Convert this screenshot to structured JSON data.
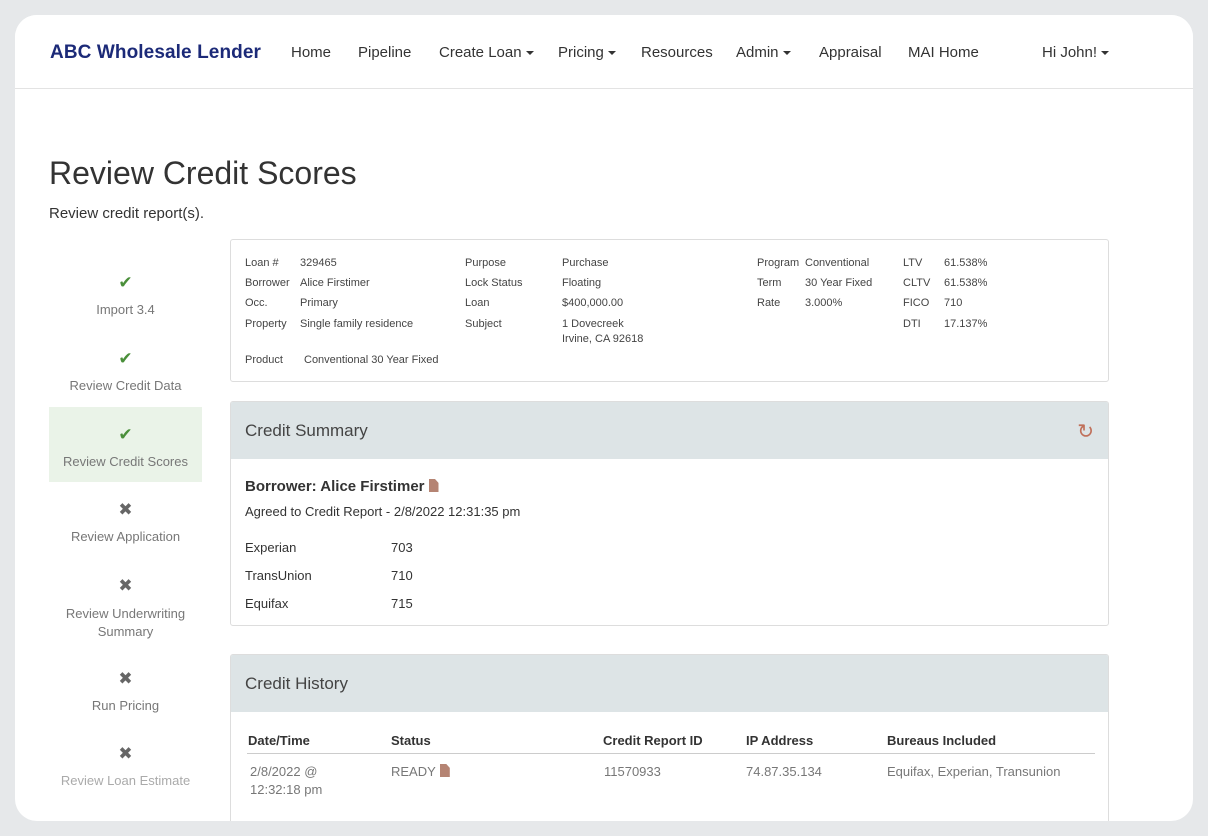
{
  "nav": {
    "brand": "ABC Wholesale Lender",
    "items": [
      {
        "label": "Home",
        "dropdown": false
      },
      {
        "label": "Pipeline",
        "dropdown": false
      },
      {
        "label": "Create Loan",
        "dropdown": true
      },
      {
        "label": "Pricing",
        "dropdown": true
      },
      {
        "label": "Resources",
        "dropdown": false
      },
      {
        "label": "Admin",
        "dropdown": true
      },
      {
        "label": "Appraisal",
        "dropdown": false
      },
      {
        "label": "MAI Home",
        "dropdown": false
      }
    ],
    "user": "Hi John!"
  },
  "page": {
    "title": "Review Credit Scores",
    "subtitle": "Review credit report(s)."
  },
  "steps": [
    {
      "label": "Import 3.4",
      "status": "check-icon"
    },
    {
      "label": "Review Credit Data",
      "status": "check-icon"
    },
    {
      "label": "Review Credit Scores",
      "status": "check-icon",
      "active": true
    },
    {
      "label": "Review Application",
      "status": "cross-icon"
    },
    {
      "label": "Review Underwriting Summary",
      "status": "cross-icon"
    },
    {
      "label": "Run Pricing",
      "status": "cross-icon"
    },
    {
      "label": "Review Loan Estimate",
      "status": "cross-icon"
    }
  ],
  "loan": {
    "loan_num_label": "Loan #",
    "loan_num": "329465",
    "borrower_label": "Borrower",
    "borrower": "Alice Firstimer",
    "occ_label": "Occ.",
    "occ": "Primary",
    "property_label": "Property",
    "property": "Single family residence",
    "product_label": "Product",
    "product": "Conventional 30 Year Fixed",
    "purpose_label": "Purpose",
    "purpose": "Purchase",
    "lock_label": "Lock Status",
    "lock": "Floating",
    "loan_label": "Loan",
    "loan_amount": "$400,000.00",
    "subject_label": "Subject",
    "subject_line1": "1 Dovecreek",
    "subject_line2": "Irvine, CA 92618",
    "program_label": "Program",
    "program": "Conventional",
    "term_label": "Term",
    "term": "30 Year Fixed",
    "rate_label": "Rate",
    "rate": "3.000%",
    "ltv_label": "LTV",
    "ltv": "61.538%",
    "cltv_label": "CLTV",
    "cltv": "61.538%",
    "fico_label": "FICO",
    "fico": "710",
    "dti_label": "DTI",
    "dti": "17.137%"
  },
  "credit_summary": {
    "title": "Credit Summary",
    "borrower_heading": "Borrower: Alice Firstimer",
    "agreed": "Agreed to Credit Report - 2/8/2022 12:31:35 pm",
    "scores": [
      {
        "bureau": "Experian",
        "score": "703"
      },
      {
        "bureau": "TransUnion",
        "score": "710"
      },
      {
        "bureau": "Equifax",
        "score": "715"
      }
    ]
  },
  "credit_history": {
    "title": "Credit History",
    "columns": [
      "Date/Time",
      "Status",
      "Credit Report ID",
      "IP Address",
      "Bureaus Included"
    ],
    "rows": [
      {
        "date_line1": "2/8/2022 @",
        "date_line2": "12:32:18 pm",
        "status": "READY",
        "report_id": "11570933",
        "ip": "74.87.35.134",
        "bureaus": "Equifax, Experian, Transunion"
      }
    ]
  },
  "colors": {
    "brand": "#1c2a78",
    "check": "#4a8f3a",
    "card_header": "#dde4e6",
    "active_step": "#eaf3e8",
    "refresh": "#c0705a"
  }
}
